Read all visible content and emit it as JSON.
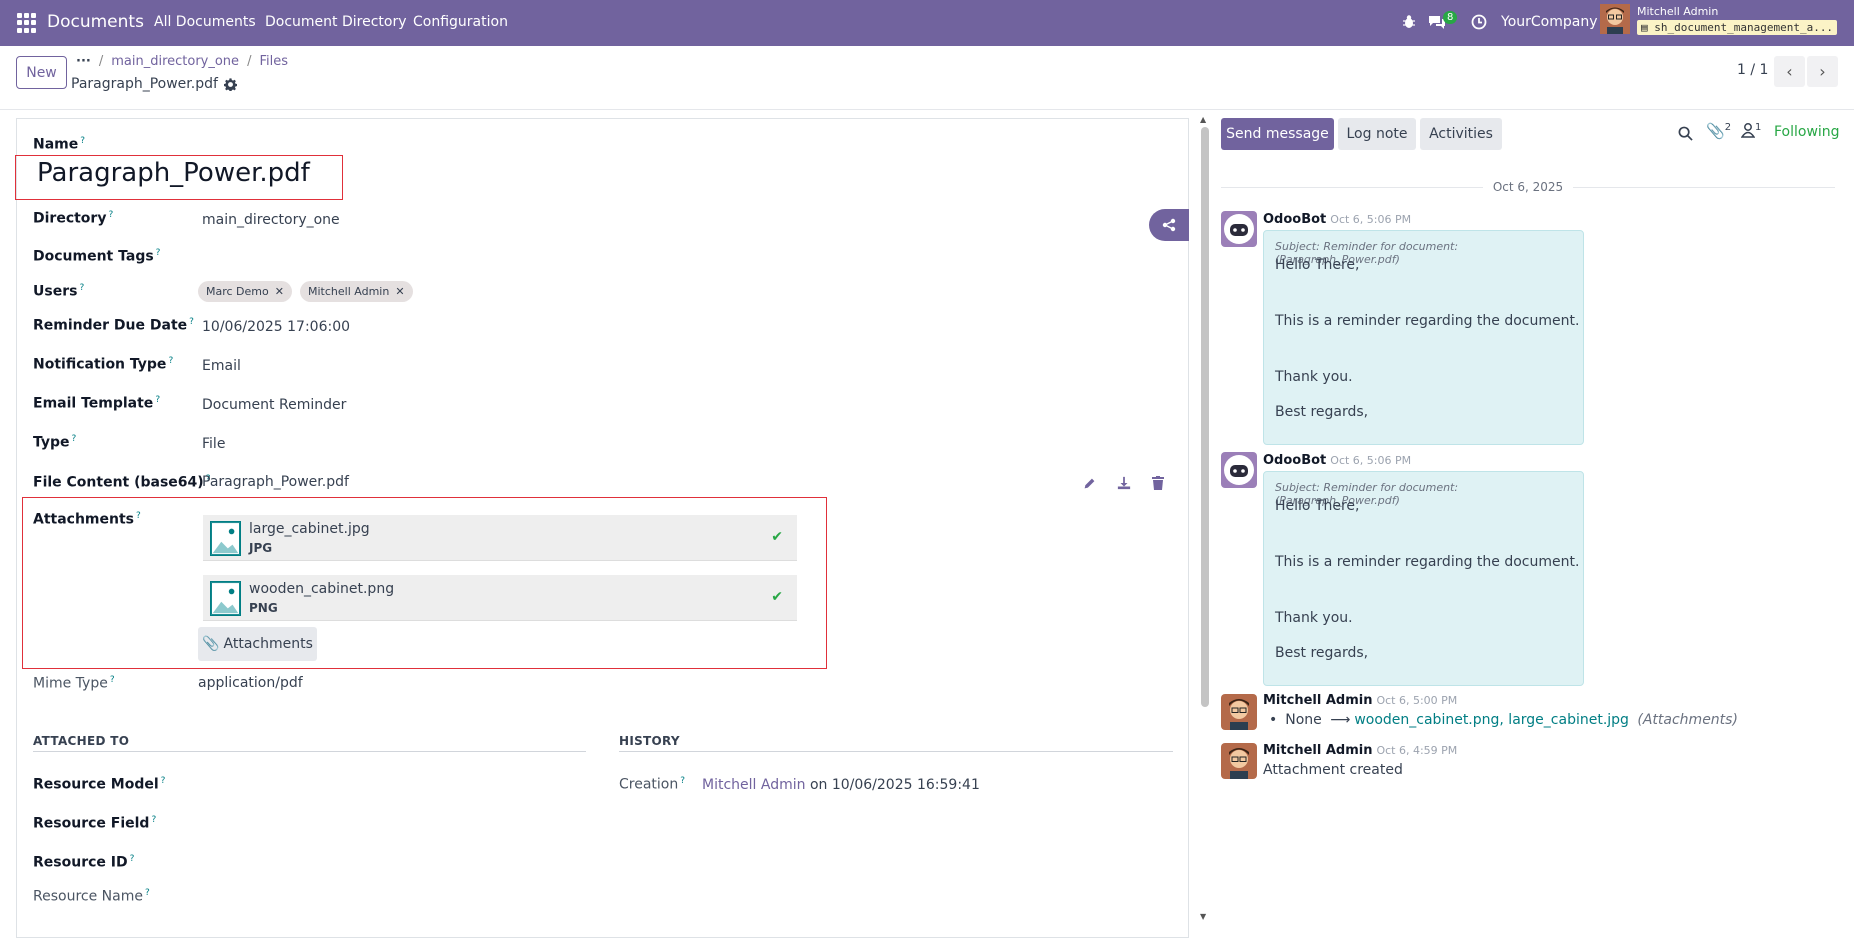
{
  "navbar": {
    "app_title": "Documents",
    "menu": [
      "All Documents",
      "Document Directory",
      "Configuration"
    ],
    "messages_count": "8",
    "company": "YourCompany",
    "user_name": "Mitchell Admin",
    "database": "sh_document_management_a..."
  },
  "control_panel": {
    "new_label": "New",
    "breadcrumb": [
      "main_directory_one",
      "Files"
    ],
    "record_name": "Paragraph_Power.pdf",
    "pager": "1 / 1"
  },
  "form": {
    "name_label": "Name",
    "name_value": "Paragraph_Power.pdf",
    "directory_label": "Directory",
    "directory_value": "main_directory_one",
    "tags_label": "Document Tags",
    "users_label": "Users",
    "users": [
      "Marc Demo",
      "Mitchell Admin"
    ],
    "reminder_label": "Reminder Due Date",
    "reminder_value": "10/06/2025 17:06:00",
    "notification_label": "Notification Type",
    "notification_value": "Email",
    "template_label": "Email Template",
    "template_value": "Document Reminder",
    "type_label": "Type",
    "type_value": "File",
    "file_content_label": "File Content (base64)",
    "file_content_value": "Paragraph_Power.pdf",
    "attachments_label": "Attachments",
    "attachments": [
      {
        "name": "large_cabinet.jpg",
        "type": "JPG"
      },
      {
        "name": "wooden_cabinet.png",
        "type": "PNG"
      }
    ],
    "attachments_button": "Attachments",
    "mime_label": "Mime Type",
    "mime_value": "application/pdf",
    "attached_to_title": "ATTACHED TO",
    "history_title": "HISTORY",
    "resource_model_label": "Resource Model",
    "resource_field_label": "Resource Field",
    "resource_id_label": "Resource ID",
    "resource_name_label": "Resource Name",
    "creation_label": "Creation",
    "creation_user": "Mitchell Admin",
    "creation_rest": " on 10/06/2025 16:59:41"
  },
  "chatter": {
    "send_message": "Send message",
    "log_note": "Log note",
    "activities": "Activities",
    "attachments_count": "2",
    "followers_count": "1",
    "following": "Following",
    "date_separator": "Oct 6, 2025",
    "messages": [
      {
        "author": "OdooBot",
        "time": "Oct 6, 5:06 PM",
        "subject": "Subject: Reminder for document: (Paragraph_Power.pdf)",
        "lines": [
          "Hello There,",
          "This is a reminder regarding the document.",
          "Thank you.",
          "Best regards,"
        ]
      },
      {
        "author": "OdooBot",
        "time": "Oct 6, 5:06 PM",
        "subject": "Subject: Reminder for document: (Paragraph_Power.pdf)",
        "lines": [
          "Hello There,",
          "This is a reminder regarding the document.",
          "Thank you.",
          "Best regards,"
        ]
      }
    ],
    "log1_author": "Mitchell Admin",
    "log1_time": "Oct 6, 5:00 PM",
    "log1_old": "None",
    "log1_new": "wooden_cabinet.png, large_cabinet.jpg",
    "log1_field": "(Attachments)",
    "log2_author": "Mitchell Admin",
    "log2_time": "Oct 6, 4:59 PM",
    "log2_text": "Attachment created"
  }
}
